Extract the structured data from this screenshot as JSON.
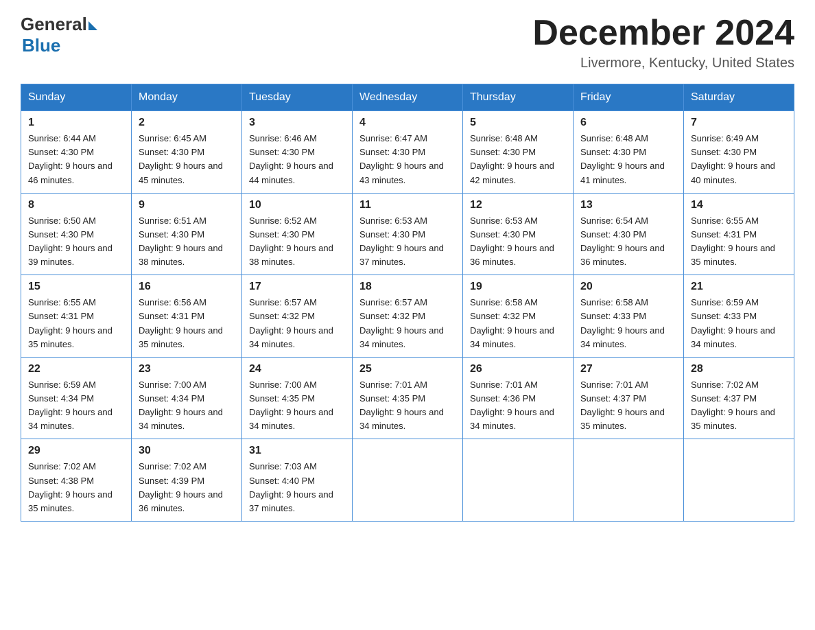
{
  "header": {
    "logo_general": "General",
    "logo_blue": "Blue",
    "title": "December 2024",
    "subtitle": "Livermore, Kentucky, United States"
  },
  "weekdays": [
    "Sunday",
    "Monday",
    "Tuesday",
    "Wednesday",
    "Thursday",
    "Friday",
    "Saturday"
  ],
  "weeks": [
    [
      {
        "day": "1",
        "sunrise": "6:44 AM",
        "sunset": "4:30 PM",
        "daylight": "9 hours and 46 minutes."
      },
      {
        "day": "2",
        "sunrise": "6:45 AM",
        "sunset": "4:30 PM",
        "daylight": "9 hours and 45 minutes."
      },
      {
        "day": "3",
        "sunrise": "6:46 AM",
        "sunset": "4:30 PM",
        "daylight": "9 hours and 44 minutes."
      },
      {
        "day": "4",
        "sunrise": "6:47 AM",
        "sunset": "4:30 PM",
        "daylight": "9 hours and 43 minutes."
      },
      {
        "day": "5",
        "sunrise": "6:48 AM",
        "sunset": "4:30 PM",
        "daylight": "9 hours and 42 minutes."
      },
      {
        "day": "6",
        "sunrise": "6:48 AM",
        "sunset": "4:30 PM",
        "daylight": "9 hours and 41 minutes."
      },
      {
        "day": "7",
        "sunrise": "6:49 AM",
        "sunset": "4:30 PM",
        "daylight": "9 hours and 40 minutes."
      }
    ],
    [
      {
        "day": "8",
        "sunrise": "6:50 AM",
        "sunset": "4:30 PM",
        "daylight": "9 hours and 39 minutes."
      },
      {
        "day": "9",
        "sunrise": "6:51 AM",
        "sunset": "4:30 PM",
        "daylight": "9 hours and 38 minutes."
      },
      {
        "day": "10",
        "sunrise": "6:52 AM",
        "sunset": "4:30 PM",
        "daylight": "9 hours and 38 minutes."
      },
      {
        "day": "11",
        "sunrise": "6:53 AM",
        "sunset": "4:30 PM",
        "daylight": "9 hours and 37 minutes."
      },
      {
        "day": "12",
        "sunrise": "6:53 AM",
        "sunset": "4:30 PM",
        "daylight": "9 hours and 36 minutes."
      },
      {
        "day": "13",
        "sunrise": "6:54 AM",
        "sunset": "4:30 PM",
        "daylight": "9 hours and 36 minutes."
      },
      {
        "day": "14",
        "sunrise": "6:55 AM",
        "sunset": "4:31 PM",
        "daylight": "9 hours and 35 minutes."
      }
    ],
    [
      {
        "day": "15",
        "sunrise": "6:55 AM",
        "sunset": "4:31 PM",
        "daylight": "9 hours and 35 minutes."
      },
      {
        "day": "16",
        "sunrise": "6:56 AM",
        "sunset": "4:31 PM",
        "daylight": "9 hours and 35 minutes."
      },
      {
        "day": "17",
        "sunrise": "6:57 AM",
        "sunset": "4:32 PM",
        "daylight": "9 hours and 34 minutes."
      },
      {
        "day": "18",
        "sunrise": "6:57 AM",
        "sunset": "4:32 PM",
        "daylight": "9 hours and 34 minutes."
      },
      {
        "day": "19",
        "sunrise": "6:58 AM",
        "sunset": "4:32 PM",
        "daylight": "9 hours and 34 minutes."
      },
      {
        "day": "20",
        "sunrise": "6:58 AM",
        "sunset": "4:33 PM",
        "daylight": "9 hours and 34 minutes."
      },
      {
        "day": "21",
        "sunrise": "6:59 AM",
        "sunset": "4:33 PM",
        "daylight": "9 hours and 34 minutes."
      }
    ],
    [
      {
        "day": "22",
        "sunrise": "6:59 AM",
        "sunset": "4:34 PM",
        "daylight": "9 hours and 34 minutes."
      },
      {
        "day": "23",
        "sunrise": "7:00 AM",
        "sunset": "4:34 PM",
        "daylight": "9 hours and 34 minutes."
      },
      {
        "day": "24",
        "sunrise": "7:00 AM",
        "sunset": "4:35 PM",
        "daylight": "9 hours and 34 minutes."
      },
      {
        "day": "25",
        "sunrise": "7:01 AM",
        "sunset": "4:35 PM",
        "daylight": "9 hours and 34 minutes."
      },
      {
        "day": "26",
        "sunrise": "7:01 AM",
        "sunset": "4:36 PM",
        "daylight": "9 hours and 34 minutes."
      },
      {
        "day": "27",
        "sunrise": "7:01 AM",
        "sunset": "4:37 PM",
        "daylight": "9 hours and 35 minutes."
      },
      {
        "day": "28",
        "sunrise": "7:02 AM",
        "sunset": "4:37 PM",
        "daylight": "9 hours and 35 minutes."
      }
    ],
    [
      {
        "day": "29",
        "sunrise": "7:02 AM",
        "sunset": "4:38 PM",
        "daylight": "9 hours and 35 minutes."
      },
      {
        "day": "30",
        "sunrise": "7:02 AM",
        "sunset": "4:39 PM",
        "daylight": "9 hours and 36 minutes."
      },
      {
        "day": "31",
        "sunrise": "7:03 AM",
        "sunset": "4:40 PM",
        "daylight": "9 hours and 37 minutes."
      },
      null,
      null,
      null,
      null
    ]
  ]
}
